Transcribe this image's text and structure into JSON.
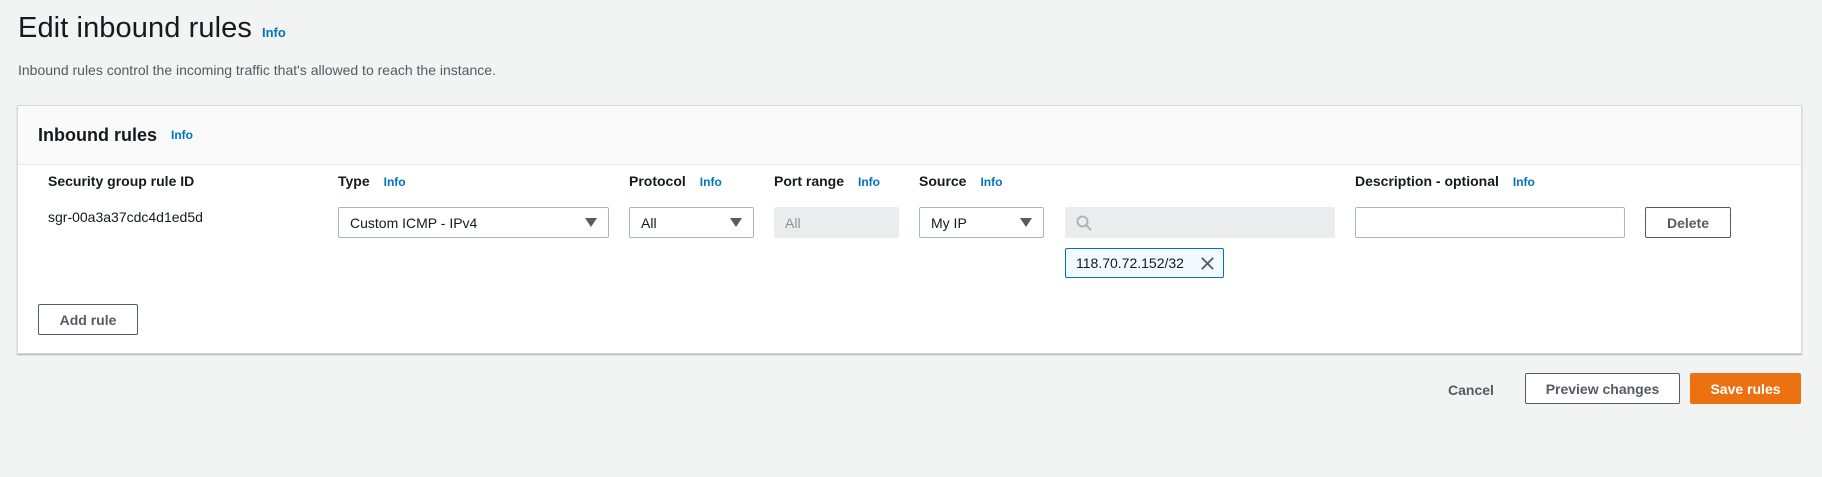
{
  "page": {
    "title": "Edit inbound rules",
    "title_info": "Info",
    "description": "Inbound rules control the incoming traffic that's allowed to reach the instance."
  },
  "panel": {
    "title": "Inbound rules",
    "info": "Info",
    "columns": {
      "rule_id": "Security group rule ID",
      "type": "Type",
      "type_info": "Info",
      "protocol": "Protocol",
      "protocol_info": "Info",
      "port_range": "Port range",
      "port_range_info": "Info",
      "source": "Source",
      "source_info": "Info",
      "description": "Description - optional",
      "description_info": "Info"
    },
    "rules": [
      {
        "rule_id": "sgr-00a3a37cdc4d1ed5d",
        "type": "Custom ICMP - IPv4",
        "protocol": "All",
        "port_range": "All",
        "source": "My IP",
        "source_search_value": "",
        "source_token": "118.70.72.152/32",
        "description": "",
        "delete_label": "Delete"
      }
    ],
    "add_rule_label": "Add rule"
  },
  "footer": {
    "cancel_label": "Cancel",
    "preview_label": "Preview changes",
    "save_label": "Save rules"
  },
  "colors": {
    "background": "#f2f3f3",
    "link": "#0073bb",
    "primary": "#ec7211",
    "token_border": "#0073bb"
  },
  "icons": {
    "dropdown": "caret-down-icon",
    "search": "search-icon",
    "remove_token": "close-icon"
  }
}
